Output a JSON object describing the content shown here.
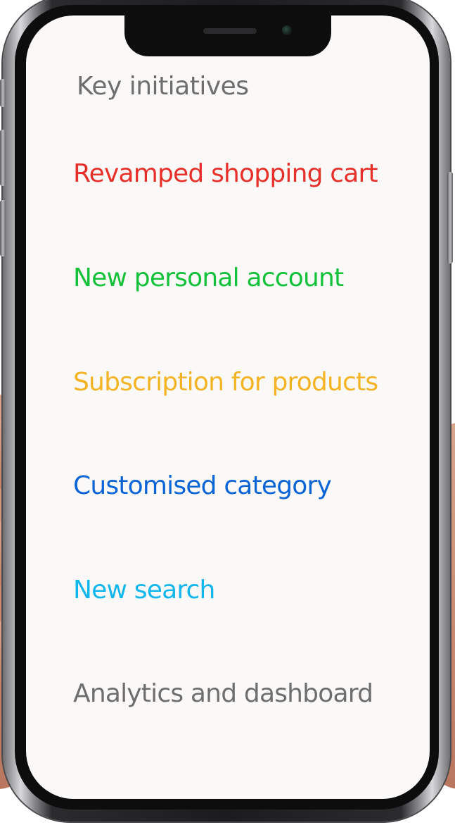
{
  "screen": {
    "title": "Key initiatives",
    "title_color": "#6e6e6e",
    "background": "#faf9f7",
    "initiatives": [
      {
        "label": "Revamped shopping cart",
        "color": "#e8302a"
      },
      {
        "label": "New personal account",
        "color": "#14c13a"
      },
      {
        "label": "Subscription for products",
        "color": "#f4b323"
      },
      {
        "label": "Customised category",
        "color": "#0b64d6"
      },
      {
        "label": "New search",
        "color": "#10b6ec"
      },
      {
        "label": "Analytics and dashboard",
        "color": "#6e6e6e"
      }
    ]
  }
}
